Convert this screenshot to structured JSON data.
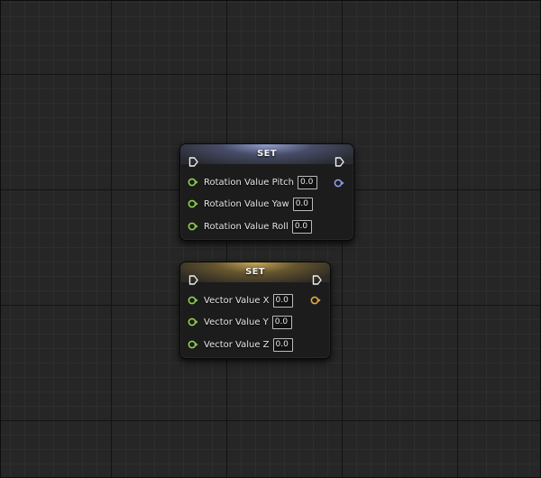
{
  "graph": {
    "nodes": [
      {
        "id": "rotation",
        "title": "SET",
        "header_color": "#8d9fd8",
        "output_pin_color": "#8e9fe8",
        "inputs": [
          {
            "label": "Rotation Value Pitch",
            "value": "0.0"
          },
          {
            "label": "Rotation Value Yaw",
            "value": "0.0"
          },
          {
            "label": "Rotation Value Roll",
            "value": "0.0"
          }
        ]
      },
      {
        "id": "vector",
        "title": "SET",
        "header_color": "#d8b050",
        "output_pin_color": "#e7a93c",
        "inputs": [
          {
            "label": "Vector Value X",
            "value": "0.0"
          },
          {
            "label": "Vector Value Y",
            "value": "0.0"
          },
          {
            "label": "Vector Value Z",
            "value": "0.0"
          }
        ]
      }
    ],
    "input_pin_color": "#8fd14f",
    "background_color": "#262626",
    "icons": {
      "exec_in": "exec-pin-icon",
      "exec_out": "exec-pin-icon",
      "float_in": "float-pin-icon",
      "struct_out": "struct-pin-icon"
    }
  }
}
